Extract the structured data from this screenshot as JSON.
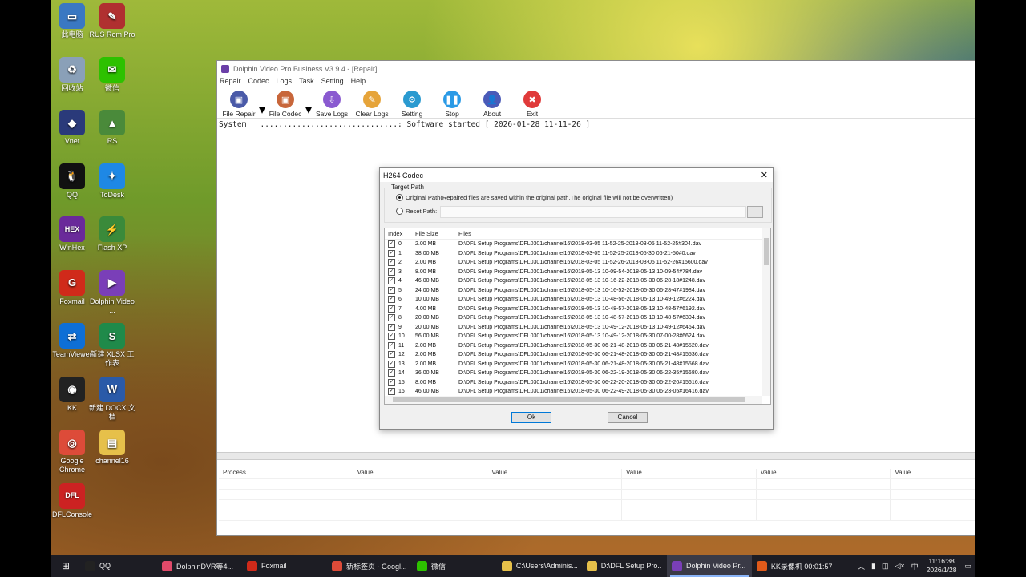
{
  "desktop_icons": [
    {
      "label": "此电脑",
      "icon": "computer-icon",
      "color": "#3a78c2",
      "glyph": "▭"
    },
    {
      "label": "RUS Rom Pro",
      "icon": "rom-tool-icon",
      "color": "#b03030",
      "glyph": "✎"
    },
    {
      "label": "回收站",
      "icon": "recycle-bin-icon",
      "color": "#8aa0b8",
      "glyph": "♻"
    },
    {
      "label": "微信",
      "icon": "wechat-icon",
      "color": "#2dc100",
      "glyph": "✉"
    },
    {
      "label": "Vnet",
      "icon": "vnet-icon",
      "color": "#2a3a7a",
      "glyph": "◆"
    },
    {
      "label": "RS",
      "icon": "rs-icon",
      "color": "#4a8a3a",
      "glyph": "▲"
    },
    {
      "label": "QQ",
      "icon": "qq-icon",
      "color": "#111111",
      "glyph": "🐧"
    },
    {
      "label": "ToDesk",
      "icon": "todesk-icon",
      "color": "#1e88e5",
      "glyph": "✦"
    },
    {
      "label": "WinHex",
      "icon": "winhex-icon",
      "color": "#6a2a9a",
      "glyph": "HEX"
    },
    {
      "label": "Flash XP",
      "icon": "flashxp-icon",
      "color": "#3a8a3a",
      "glyph": "⚡"
    },
    {
      "label": "Foxmail",
      "icon": "foxmail-icon",
      "color": "#d02a1a",
      "glyph": "G"
    },
    {
      "label": "Dolphin Video ...",
      "icon": "dolphin-icon",
      "color": "#7a3fb8",
      "glyph": "▶"
    },
    {
      "label": "TeamViewer",
      "icon": "teamviewer-icon",
      "color": "#0e6fd6",
      "glyph": "⇄"
    },
    {
      "label": "新建 XLSX 工作表",
      "icon": "xlsx-icon",
      "color": "#1f8a4a",
      "glyph": "S"
    },
    {
      "label": "KK",
      "icon": "kk-icon",
      "color": "#222222",
      "glyph": "◉"
    },
    {
      "label": "新建 DOCX 文档",
      "icon": "docx-icon",
      "color": "#2a5aa8",
      "glyph": "W"
    },
    {
      "label": "Google Chrome",
      "icon": "chrome-icon",
      "color": "#dd4b39",
      "glyph": "◎"
    },
    {
      "label": "channel16",
      "icon": "folder-icon",
      "color": "#e6c04a",
      "glyph": "▤"
    },
    {
      "label": "DFLConsole",
      "icon": "dfl-icon",
      "color": "#cc2222",
      "glyph": "DFL"
    }
  ],
  "window": {
    "title": "Dolphin Video Pro Business V3.9.4 - [Repair]",
    "menu": [
      "Repair",
      "Codec",
      "Logs",
      "Task",
      "Setting",
      "Help"
    ],
    "toolbar": [
      {
        "label": "File Repair",
        "icon": "file-repair-icon",
        "color": "#4a5aa8",
        "glyph": "▣",
        "drop": true
      },
      {
        "label": "File Codec",
        "icon": "file-codec-icon",
        "color": "#c8663a",
        "glyph": "▣",
        "drop": true
      },
      {
        "label": "Save Logs",
        "icon": "save-logs-icon",
        "color": "#8a5ad0",
        "glyph": "⇩",
        "drop": false
      },
      {
        "label": "Clear Logs",
        "icon": "clear-logs-icon",
        "color": "#e6a43a",
        "glyph": "✎",
        "drop": false
      },
      {
        "label": "Setting",
        "icon": "setting-icon",
        "color": "#2a9ad0",
        "glyph": "⚙",
        "drop": false
      },
      {
        "label": "Stop",
        "icon": "stop-icon",
        "color": "#2a9ae6",
        "glyph": "❚❚",
        "drop": false
      },
      {
        "label": "About",
        "icon": "about-icon",
        "color": "#4a5ab8",
        "glyph": "👤",
        "drop": false
      },
      {
        "label": "Exit",
        "icon": "exit-icon",
        "color": "#e03a3a",
        "glyph": "✖",
        "drop": false
      }
    ],
    "log": "System   ..............................: Software started [ 2026-01-28 11-11-26 ]",
    "process_headers": [
      "Process",
      "Value",
      "Value",
      "Value",
      "Value",
      "Value"
    ]
  },
  "dialog": {
    "title": "H264 Codec",
    "group_label": "Target Path",
    "original_path": "Original Path(Repaired files are saved within the original path,The original file will not be overwritten)",
    "reset_path": "Reset Path:",
    "browse": "...",
    "columns": [
      "Index",
      "File Size",
      "Files"
    ],
    "rows": [
      {
        "i": "0",
        "s": "2.00 MB",
        "f": "D:\\DFL Setup Programs\\DFL0301\\channel16\\2018-03-05 11-52-25-2018-03-05 11-52-25#304.dav"
      },
      {
        "i": "1",
        "s": "38.00 MB",
        "f": "D:\\DFL Setup Programs\\DFL0301\\channel16\\2018-03-05 11-52-25-2018-05-30 06-21-50#0.dav"
      },
      {
        "i": "2",
        "s": "2.00 MB",
        "f": "D:\\DFL Setup Programs\\DFL0301\\channel16\\2018-03-05 11-52-26-2018-03-05 11-52-26#15600.dav"
      },
      {
        "i": "3",
        "s": "8.00 MB",
        "f": "D:\\DFL Setup Programs\\DFL0301\\channel16\\2018-05-13 10-09-54-2018-05-13 10-09-54#784.dav"
      },
      {
        "i": "4",
        "s": "46.00 MB",
        "f": "D:\\DFL Setup Programs\\DFL0301\\channel16\\2018-05-13 10-16-22-2018-05-30 06-28-18#1248.dav"
      },
      {
        "i": "5",
        "s": "24.00 MB",
        "f": "D:\\DFL Setup Programs\\DFL0301\\channel16\\2018-05-13 10-16-52-2018-05-30 06-28-47#1984.dav"
      },
      {
        "i": "6",
        "s": "10.00 MB",
        "f": "D:\\DFL Setup Programs\\DFL0301\\channel16\\2018-05-13 10-48-56-2018-05-13 10-49-12#6224.dav"
      },
      {
        "i": "7",
        "s": "4.00 MB",
        "f": "D:\\DFL Setup Programs\\DFL0301\\channel16\\2018-05-13 10-48-57-2018-05-13 10-48-57#6192.dav"
      },
      {
        "i": "8",
        "s": "20.00 MB",
        "f": "D:\\DFL Setup Programs\\DFL0301\\channel16\\2018-05-13 10-48-57-2018-05-13 10-48-57#6304.dav"
      },
      {
        "i": "9",
        "s": "20.00 MB",
        "f": "D:\\DFL Setup Programs\\DFL0301\\channel16\\2018-05-13 10-49-12-2018-05-13 10-49-12#6464.dav"
      },
      {
        "i": "10",
        "s": "56.00 MB",
        "f": "D:\\DFL Setup Programs\\DFL0301\\channel16\\2018-05-13 10-49-12-2018-05-30 07-00-28#6624.dav"
      },
      {
        "i": "11",
        "s": "2.00 MB",
        "f": "D:\\DFL Setup Programs\\DFL0301\\channel16\\2018-05-30 06-21-48-2018-05-30 06-21-48#15520.dav"
      },
      {
        "i": "12",
        "s": "2.00 MB",
        "f": "D:\\DFL Setup Programs\\DFL0301\\channel16\\2018-05-30 06-21-48-2018-05-30 06-21-48#15536.dav"
      },
      {
        "i": "13",
        "s": "2.00 MB",
        "f": "D:\\DFL Setup Programs\\DFL0301\\channel16\\2018-05-30 06-21-48-2018-05-30 06-21-48#15568.dav"
      },
      {
        "i": "14",
        "s": "36.00 MB",
        "f": "D:\\DFL Setup Programs\\DFL0301\\channel16\\2018-05-30 06-22-19-2018-05-30 06-22-35#15680.dav"
      },
      {
        "i": "15",
        "s": "8.00 MB",
        "f": "D:\\DFL Setup Programs\\DFL0301\\channel16\\2018-05-30 06-22-20-2018-05-30 06-22-20#15616.dav"
      },
      {
        "i": "16",
        "s": "46.00 MB",
        "f": "D:\\DFL Setup Programs\\DFL0301\\channel16\\2018-05-30 06-22-49-2018-05-30 06-23-05#16416.dav"
      }
    ],
    "ok": "Ok",
    "cancel": "Cancel"
  },
  "taskbar": {
    "items": [
      {
        "label": "QQ",
        "icon": "qq-icon",
        "color": "#222"
      },
      {
        "label": "DolphinDVR等4...",
        "icon": "dolphin-dvr-icon",
        "color": "#e04a6a"
      },
      {
        "label": "Foxmail",
        "icon": "foxmail-icon",
        "color": "#d02a1a"
      },
      {
        "label": "新标签页 - Googl...",
        "icon": "chrome-icon",
        "color": "#dd4b39"
      },
      {
        "label": "微信",
        "icon": "wechat-icon",
        "color": "#2dc100"
      },
      {
        "label": "C:\\Users\\Adminis...",
        "icon": "folder-icon",
        "color": "#e6c04a"
      },
      {
        "label": "D:\\DFL Setup Pro...",
        "icon": "folder-icon",
        "color": "#e6c04a"
      },
      {
        "label": "Dolphin Video Pr...",
        "icon": "dolphin-icon",
        "color": "#7a3fb8",
        "active": true
      },
      {
        "label": "KK录像机 00:01:57",
        "icon": "kk-recorder-icon",
        "color": "#e05a1a"
      }
    ],
    "ime": "中",
    "time": "11:16:38",
    "date": "2026/1/28"
  }
}
